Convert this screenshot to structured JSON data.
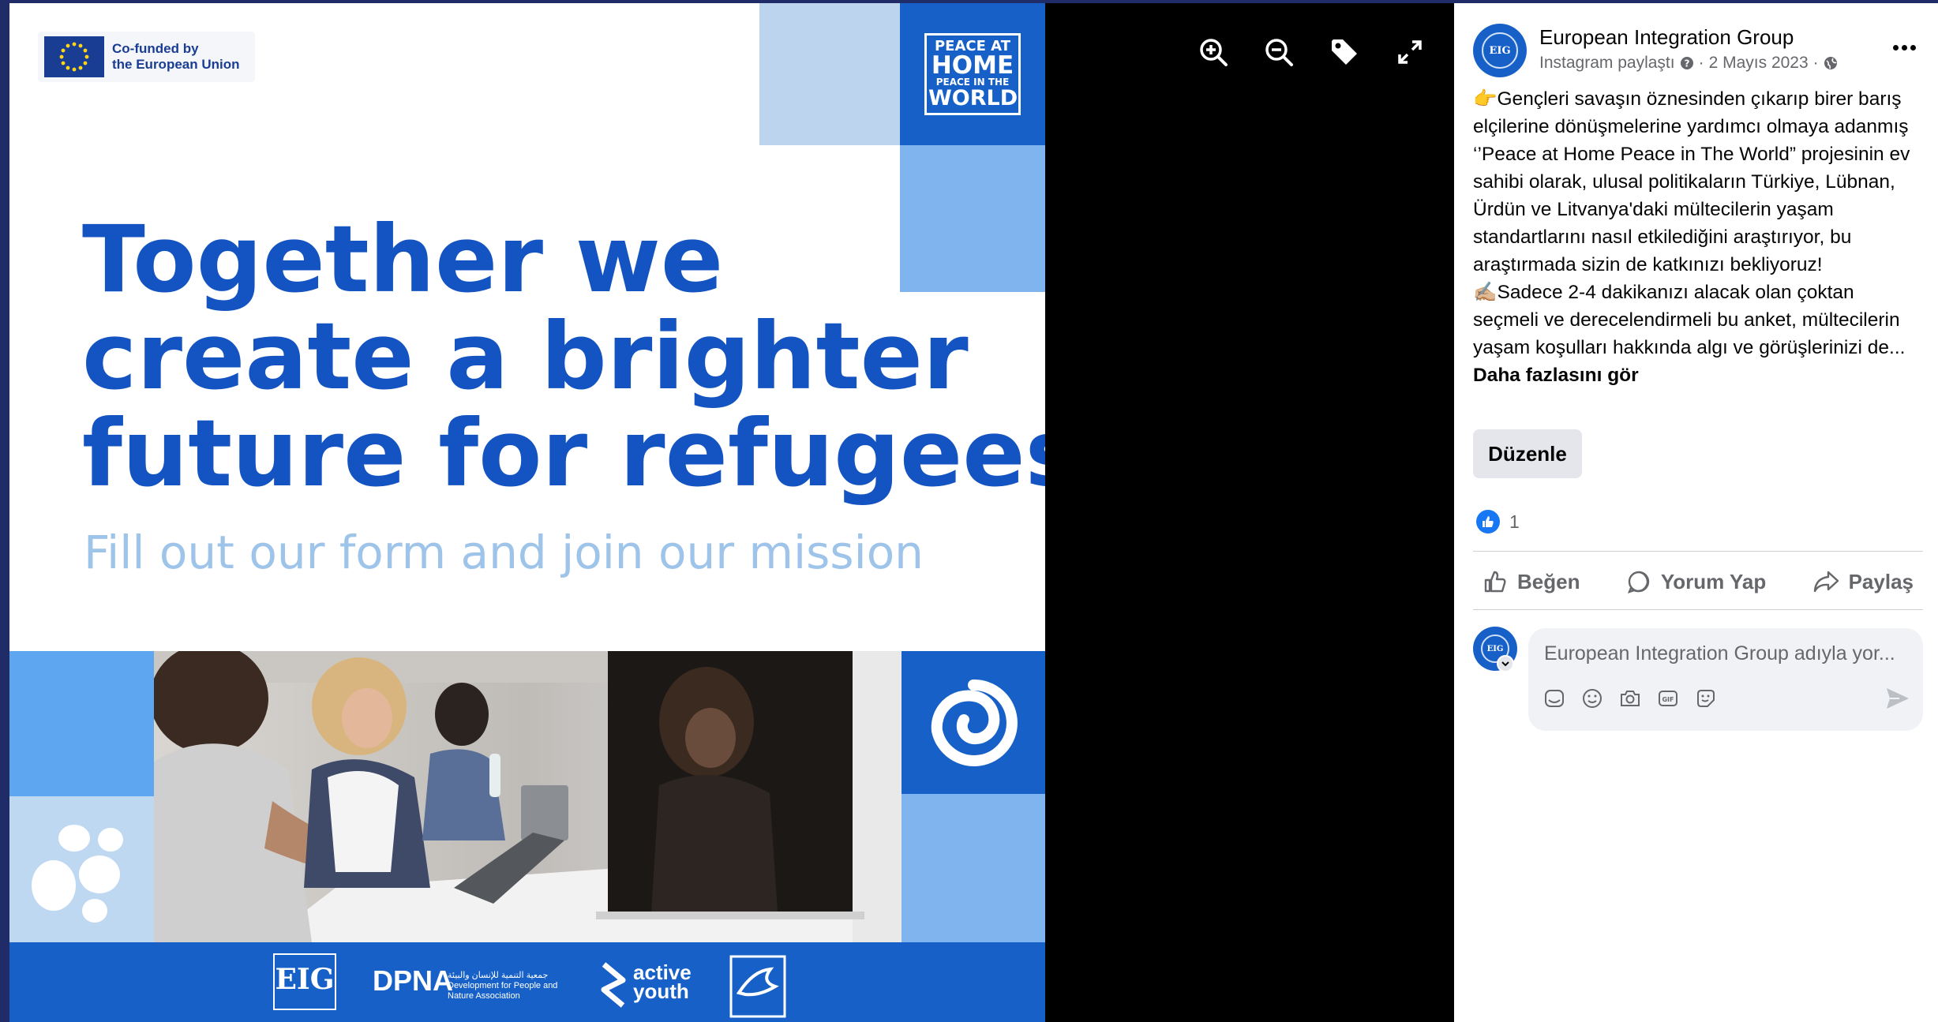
{
  "poster": {
    "eu_line1": "Co-funded by",
    "eu_line2": "the European Union",
    "pah_l1": "PEACE AT",
    "pah_l2": "HOME",
    "pah_l3": "PEACE IN THE",
    "pah_l4": "WORLD",
    "headline": [
      "Together we",
      "create a brighter",
      "future for refugees"
    ],
    "subline": "Fill out our form and join our mission",
    "partners": {
      "eig": "EIG",
      "dpna": "DPNA",
      "dpna_sub": "جمعية التنمية للإنسان والبيئة Development for People and Nature Association",
      "active_l1": "active",
      "active_l2": "youth"
    }
  },
  "viewer": {
    "controls": [
      "zoom-in-icon",
      "zoom-out-icon",
      "tag-icon",
      "fullscreen-icon"
    ]
  },
  "post": {
    "page_name": "European Integration Group",
    "avatar_text": "EIG",
    "meta_source": "Instagram paylaştı",
    "meta_date": "2 Mayıs 2023",
    "meta_sep": "·",
    "text_p1": "👉Gençleri savaşın öznesinden çıkarıp birer barış elçilerine dönüşmelerine yardımcı olmaya adanmış ‘’Peace at Home Peace in The World” projesinin ev sahibi olarak, ulusal politikaların Türkiye, Lübnan, Ürdün ve Litvanya'daki mültecilerin yaşam standartlarını nasıl etkilediğini araştırıyor, bu araştırmada sizin de katkınızı bekliyoruz!",
    "text_p2": "✍🏼Sadece 2-4 dakikanızı alacak olan çoktan seçmeli ve derecelendirmeli bu anket, mültecilerin yaşam koşulları hakkında algı ve görüşlerinizi de...",
    "see_more": "Daha fazlasını gör",
    "edit_label": "Düzenle",
    "like_count": "1",
    "actions": {
      "like": "Beğen",
      "comment": "Yorum Yap",
      "share": "Paylaş"
    },
    "comment_placeholder": "European Integration Group adıyla yor...",
    "accent": "#1877f2",
    "brand_blue": "#1760c8"
  }
}
